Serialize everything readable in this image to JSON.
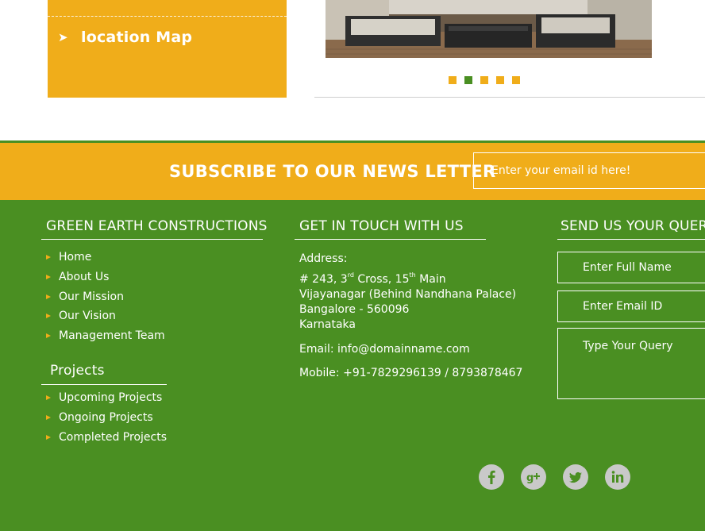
{
  "sidebar": {
    "items": [
      {
        "label": "location Map"
      }
    ]
  },
  "slider": {
    "dots": 5,
    "active_index": 1
  },
  "newsletter": {
    "title": "SUBSCRIBE TO OUR NEWS LETTER",
    "email_placeholder": "Enter your email id here!"
  },
  "footer": {
    "company": {
      "title": "GREEN EARTH CONSTRUCTIONS",
      "links": [
        "Home",
        "About Us",
        "Our Mission",
        "Our Vision",
        "Management Team"
      ]
    },
    "projects": {
      "title": "Projects",
      "links": [
        "Upcoming Projects",
        "Ongoing Projects",
        "Completed Projects"
      ]
    },
    "contact": {
      "title": "GET IN TOUCH WITH US",
      "address_label": "Address:",
      "address_line1_a": "# 243, 3",
      "address_line1_sup1": "rd",
      "address_line1_b": " Cross, 15",
      "address_line1_sup2": "th",
      "address_line1_c": " Main",
      "address_line2": "Vijayanagar (Behind Nandhana Palace)",
      "address_line3": "Bangalore - 560096",
      "address_line4": "Karnataka",
      "email": "Email: info@domainname.com",
      "mobile": "Mobile: +91-7829296139 / 8793878467"
    },
    "query": {
      "title": "SEND US YOUR QUERY",
      "name_placeholder": "Enter Full Name",
      "email_placeholder": "Enter Email ID",
      "query_placeholder": "Type Your Query"
    },
    "social": [
      "facebook-icon",
      "google-plus-icon",
      "twitter-icon",
      "linkedin-icon"
    ]
  },
  "colors": {
    "accent": "#f0ad1a",
    "green": "#4a8f22",
    "social_gray": "#c9c9c9"
  }
}
